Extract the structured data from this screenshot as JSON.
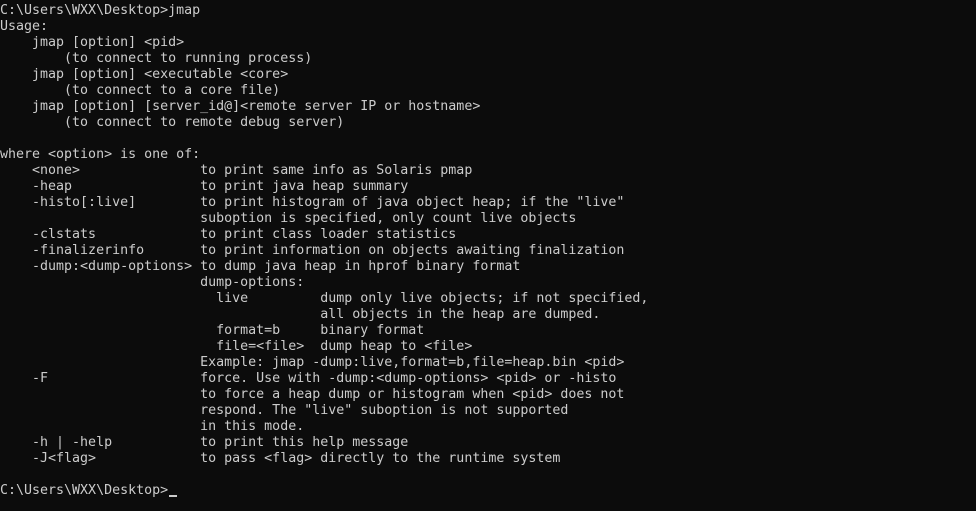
{
  "console": {
    "lines": [
      "C:\\Users\\WXX\\Desktop>jmap",
      "Usage:",
      "    jmap [option] <pid>",
      "        (to connect to running process)",
      "    jmap [option] <executable <core>",
      "        (to connect to a core file)",
      "    jmap [option] [server_id@]<remote server IP or hostname>",
      "        (to connect to remote debug server)",
      "",
      "where <option> is one of:",
      "    <none>               to print same info as Solaris pmap",
      "    -heap                to print java heap summary",
      "    -histo[:live]        to print histogram of java object heap; if the \"live\"",
      "                         suboption is specified, only count live objects",
      "    -clstats             to print class loader statistics",
      "    -finalizerinfo       to print information on objects awaiting finalization",
      "    -dump:<dump-options> to dump java heap in hprof binary format",
      "                         dump-options:",
      "                           live         dump only live objects; if not specified,",
      "                                        all objects in the heap are dumped.",
      "                           format=b     binary format",
      "                           file=<file>  dump heap to <file>",
      "                         Example: jmap -dump:live,format=b,file=heap.bin <pid>",
      "    -F                   force. Use with -dump:<dump-options> <pid> or -histo",
      "                         to force a heap dump or histogram when <pid> does not",
      "                         respond. The \"live\" suboption is not supported",
      "                         in this mode.",
      "    -h | -help           to print this help message",
      "    -J<flag>             to pass <flag> directly to the runtime system",
      "",
      "C:\\Users\\WXX\\Desktop>"
    ]
  }
}
